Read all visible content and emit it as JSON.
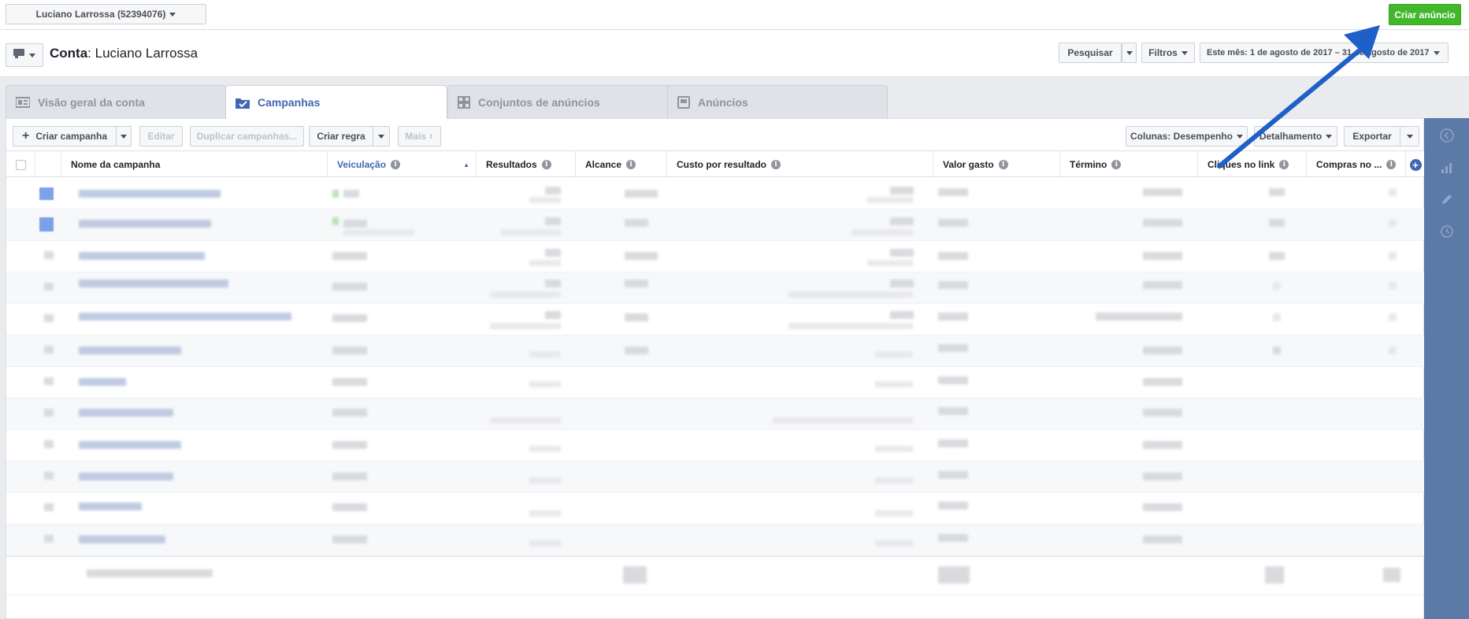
{
  "topbar": {
    "account_selector": "Luciano Larrossa (52394076)",
    "create_ad": "Criar anúncio"
  },
  "header": {
    "title_prefix": "Conta",
    "title_name": ": Luciano Larrossa",
    "search": "Pesquisar",
    "filters": "Filtros",
    "date_range": "Este mês: 1 de agosto de 2017 – 31 de agosto de 2017"
  },
  "tabs": [
    {
      "label": "Visão geral da conta",
      "icon": "account-overview-icon",
      "active": false
    },
    {
      "label": "Campanhas",
      "icon": "campaigns-icon",
      "active": true
    },
    {
      "label": "Conjuntos de anúncios",
      "icon": "adsets-grid-icon",
      "active": false
    },
    {
      "label": "Anúncios",
      "icon": "ads-icon",
      "active": false
    }
  ],
  "toolbar": {
    "create_campaign": "Criar campanha",
    "edit": "Editar",
    "duplicate": "Duplicar campanhas...",
    "create_rule": "Criar regra",
    "more": "Mais",
    "columns": "Colunas: Desempenho",
    "breakdown": "Detalhamento",
    "export": "Exportar"
  },
  "table": {
    "columns": [
      "Nome da campanha",
      "Veiculação",
      "Resultados",
      "Alcance",
      "Custo por resultado",
      "Valor gasto",
      "Término",
      "Cliques no link",
      "Compras no ..."
    ],
    "sorted_column": "Veiculação",
    "row_count_visible": 13
  },
  "colors": {
    "accent": "#4267b2",
    "create_green": "#42b72a",
    "rail": "#5b7aa8",
    "arrow": "#1f5fc9"
  }
}
